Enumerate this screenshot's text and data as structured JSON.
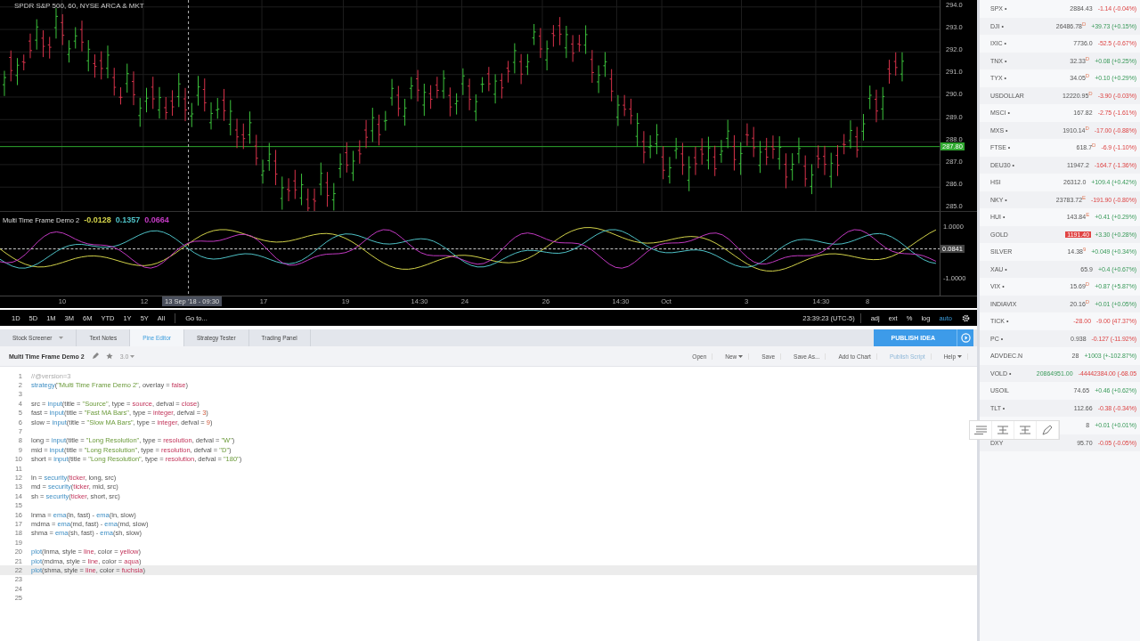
{
  "chart": {
    "title": "SPDR S&P 500, 60, NYSE ARCA & MKT",
    "price_axis": [
      "294.0",
      "293.0",
      "292.0",
      "291.0",
      "290.0",
      "289.0",
      "288.0",
      "287.0",
      "286.0",
      "285.0"
    ],
    "last_price": "287.80",
    "indicator": {
      "name": "Multi Time Frame Demo 2",
      "values": [
        {
          "text": "-0.0128",
          "color": "#d4d44a"
        },
        {
          "text": "0.1357",
          "color": "#4fc3c8"
        },
        {
          "text": "0.0664",
          "color": "#c43ac4"
        }
      ],
      "axis": [
        "1.0000",
        "-1.0000"
      ],
      "last_value": "0.0841"
    },
    "time_axis": [
      "10",
      "12",
      "17",
      "19",
      "14:30",
      "24",
      "26",
      "14:30",
      "Oct",
      "3",
      "14:30",
      "8"
    ],
    "crosshair_time": "13 Sep '18 - 09:30"
  },
  "toolbar": {
    "ranges": [
      "1D",
      "5D",
      "1M",
      "3M",
      "6M",
      "YTD",
      "1Y",
      "5Y",
      "All"
    ],
    "goto": "Go to...",
    "clock": "23:39:23 (UTC-5)",
    "toggles": [
      {
        "label": "adj",
        "on": false
      },
      {
        "label": "ext",
        "on": false
      },
      {
        "label": "%",
        "on": false
      },
      {
        "label": "log",
        "on": false
      },
      {
        "label": "auto",
        "on": true
      }
    ]
  },
  "tabs": [
    {
      "label": "Stock Screener",
      "selected": false,
      "dropdown": true
    },
    {
      "label": "Text Notes",
      "selected": false,
      "dropdown": false
    },
    {
      "label": "Pine Editor",
      "selected": true,
      "dropdown": false
    },
    {
      "label": "Strategy Tester",
      "selected": false,
      "dropdown": false
    },
    {
      "label": "Trading Panel",
      "selected": false,
      "dropdown": false
    }
  ],
  "publish_button": "PUBLISH IDEA",
  "editor": {
    "script_name": "Multi Time Frame Demo 2",
    "version": "3.0",
    "actions": [
      {
        "label": "Open",
        "dropdown": false,
        "muted": false
      },
      {
        "label": "New",
        "dropdown": true,
        "muted": false
      },
      {
        "label": "Save",
        "dropdown": false,
        "muted": false
      },
      {
        "label": "Save As...",
        "dropdown": false,
        "muted": false
      },
      {
        "label": "Add to Chart",
        "dropdown": false,
        "muted": false
      },
      {
        "label": "Publish Script",
        "dropdown": false,
        "muted": true
      },
      {
        "label": "Help",
        "dropdown": true,
        "muted": false
      }
    ],
    "lines": [
      {
        "number": "1",
        "current": false,
        "tokens": [
          {
            "text": "//@version=3",
            "kind": "comment"
          }
        ]
      },
      {
        "number": "2",
        "current": false,
        "tokens": [
          {
            "text": "strategy",
            "kind": "func"
          },
          {
            "text": "(",
            "kind": "plain"
          },
          {
            "text": "\"Multi Time Frame Demo 2\"",
            "kind": "string"
          },
          {
            "text": ", overlay = ",
            "kind": "plain"
          },
          {
            "text": "false",
            "kind": "keyword"
          },
          {
            "text": ")",
            "kind": "plain"
          }
        ]
      },
      {
        "number": "3",
        "current": false
      },
      {
        "number": "4",
        "current": false,
        "tokens": [
          {
            "text": "src = ",
            "kind": "plain"
          },
          {
            "text": "input",
            "kind": "func"
          },
          {
            "text": "(title = ",
            "kind": "plain"
          },
          {
            "text": "\"Source\"",
            "kind": "string"
          },
          {
            "text": ", type = ",
            "kind": "plain"
          },
          {
            "text": "source",
            "kind": "keyword"
          },
          {
            "text": ", defval = ",
            "kind": "plain"
          },
          {
            "text": "close",
            "kind": "keyword"
          },
          {
            "text": ")",
            "kind": "plain"
          }
        ]
      },
      {
        "number": "5",
        "current": false,
        "tokens": [
          {
            "text": "fast = ",
            "kind": "plain"
          },
          {
            "text": "input",
            "kind": "func"
          },
          {
            "text": "(title = ",
            "kind": "plain"
          },
          {
            "text": "\"Fast MA Bars\"",
            "kind": "string"
          },
          {
            "text": ", type = ",
            "kind": "plain"
          },
          {
            "text": "integer",
            "kind": "keyword"
          },
          {
            "text": ", defval = ",
            "kind": "plain"
          },
          {
            "text": "3",
            "kind": "number"
          },
          {
            "text": ")",
            "kind": "plain"
          }
        ]
      },
      {
        "number": "6",
        "current": false,
        "tokens": [
          {
            "text": "slow = ",
            "kind": "plain"
          },
          {
            "text": "input",
            "kind": "func"
          },
          {
            "text": "(title = ",
            "kind": "plain"
          },
          {
            "text": "\"Slow MA Bars\"",
            "kind": "string"
          },
          {
            "text": ", type = ",
            "kind": "plain"
          },
          {
            "text": "integer",
            "kind": "keyword"
          },
          {
            "text": ", defval = ",
            "kind": "plain"
          },
          {
            "text": "9",
            "kind": "number"
          },
          {
            "text": ")",
            "kind": "plain"
          }
        ]
      },
      {
        "number": "7",
        "current": false
      },
      {
        "number": "8",
        "current": false,
        "tokens": [
          {
            "text": "long = ",
            "kind": "plain"
          },
          {
            "text": "input",
            "kind": "func"
          },
          {
            "text": "(title = ",
            "kind": "plain"
          },
          {
            "text": "\"Long Resolution\"",
            "kind": "string"
          },
          {
            "text": ", type = ",
            "kind": "plain"
          },
          {
            "text": "resolution",
            "kind": "keyword"
          },
          {
            "text": ", defval = ",
            "kind": "plain"
          },
          {
            "text": "\"W\"",
            "kind": "string"
          },
          {
            "text": ")",
            "kind": "plain"
          }
        ]
      },
      {
        "number": "9",
        "current": false,
        "tokens": [
          {
            "text": "mid = ",
            "kind": "plain"
          },
          {
            "text": "input",
            "kind": "func"
          },
          {
            "text": "(title = ",
            "kind": "plain"
          },
          {
            "text": "\"Long Resolution\"",
            "kind": "string"
          },
          {
            "text": ", type = ",
            "kind": "plain"
          },
          {
            "text": "resolution",
            "kind": "keyword"
          },
          {
            "text": ", defval = ",
            "kind": "plain"
          },
          {
            "text": "\"D\"",
            "kind": "string"
          },
          {
            "text": ")",
            "kind": "plain"
          }
        ]
      },
      {
        "number": "10",
        "current": false,
        "tokens": [
          {
            "text": "short = ",
            "kind": "plain"
          },
          {
            "text": "input",
            "kind": "func"
          },
          {
            "text": "(title = ",
            "kind": "plain"
          },
          {
            "text": "\"Long Resolution\"",
            "kind": "string"
          },
          {
            "text": ", type = ",
            "kind": "plain"
          },
          {
            "text": "resolution",
            "kind": "keyword"
          },
          {
            "text": ", defval = ",
            "kind": "plain"
          },
          {
            "text": "\"180\"",
            "kind": "string"
          },
          {
            "text": ")",
            "kind": "plain"
          }
        ]
      },
      {
        "number": "11",
        "current": false
      },
      {
        "number": "12",
        "current": false,
        "tokens": [
          {
            "text": "ln = ",
            "kind": "plain"
          },
          {
            "text": "security",
            "kind": "func"
          },
          {
            "text": "(",
            "kind": "plain"
          },
          {
            "text": "ticker",
            "kind": "keyword"
          },
          {
            "text": ", long, src)",
            "kind": "plain"
          }
        ]
      },
      {
        "number": "13",
        "current": false,
        "tokens": [
          {
            "text": "md = ",
            "kind": "plain"
          },
          {
            "text": "security",
            "kind": "func"
          },
          {
            "text": "(",
            "kind": "plain"
          },
          {
            "text": "ticker",
            "kind": "keyword"
          },
          {
            "text": ", mid, src)",
            "kind": "plain"
          }
        ]
      },
      {
        "number": "14",
        "current": false,
        "tokens": [
          {
            "text": "sh = ",
            "kind": "plain"
          },
          {
            "text": "security",
            "kind": "func"
          },
          {
            "text": "(",
            "kind": "plain"
          },
          {
            "text": "ticker",
            "kind": "keyword"
          },
          {
            "text": ", short, src)",
            "kind": "plain"
          }
        ]
      },
      {
        "number": "15",
        "current": false
      },
      {
        "number": "16",
        "current": false,
        "tokens": [
          {
            "text": "lnma = ",
            "kind": "plain"
          },
          {
            "text": "ema",
            "kind": "func"
          },
          {
            "text": "(ln, fast) - ",
            "kind": "plain"
          },
          {
            "text": "ema",
            "kind": "func"
          },
          {
            "text": "(ln, slow)",
            "kind": "plain"
          }
        ]
      },
      {
        "number": "17",
        "current": false,
        "tokens": [
          {
            "text": "mdma = ",
            "kind": "plain"
          },
          {
            "text": "ema",
            "kind": "func"
          },
          {
            "text": "(md, fast) - ",
            "kind": "plain"
          },
          {
            "text": "ema",
            "kind": "func"
          },
          {
            "text": "(md, slow)",
            "kind": "plain"
          }
        ]
      },
      {
        "number": "18",
        "current": false,
        "tokens": [
          {
            "text": "shma = ",
            "kind": "plain"
          },
          {
            "text": "ema",
            "kind": "func"
          },
          {
            "text": "(sh, fast) - ",
            "kind": "plain"
          },
          {
            "text": "ema",
            "kind": "func"
          },
          {
            "text": "(sh, slow)",
            "kind": "plain"
          }
        ]
      },
      {
        "number": "19",
        "current": false
      },
      {
        "number": "20",
        "current": false,
        "tokens": [
          {
            "text": "plot",
            "kind": "func"
          },
          {
            "text": "(lnma, style = ",
            "kind": "plain"
          },
          {
            "text": "line",
            "kind": "keyword"
          },
          {
            "text": ", color = ",
            "kind": "plain"
          },
          {
            "text": "yellow",
            "kind": "keyword"
          },
          {
            "text": ")",
            "kind": "plain"
          }
        ]
      },
      {
        "number": "21",
        "current": false,
        "tokens": [
          {
            "text": "plot",
            "kind": "func"
          },
          {
            "text": "(mdma, style = ",
            "kind": "plain"
          },
          {
            "text": "line",
            "kind": "keyword"
          },
          {
            "text": ", color = ",
            "kind": "plain"
          },
          {
            "text": "aqua",
            "kind": "keyword"
          },
          {
            "text": ")",
            "kind": "plain"
          }
        ]
      },
      {
        "number": "22",
        "current": true,
        "tokens": [
          {
            "text": "plot",
            "kind": "func"
          },
          {
            "text": "(shma, style = ",
            "kind": "plain"
          },
          {
            "text": "line",
            "kind": "keyword"
          },
          {
            "text": ", color = ",
            "kind": "plain"
          },
          {
            "text": "fuchsia",
            "kind": "keyword"
          },
          {
            "text": ")",
            "kind": "plain"
          }
        ]
      },
      {
        "number": "23",
        "current": false
      },
      {
        "number": "24",
        "current": false
      },
      {
        "number": "25",
        "current": false
      }
    ]
  },
  "watchlist": [
    {
      "symbol": "SPX •",
      "price": "2884.43",
      "highlighted": false,
      "price_down": false,
      "price_up": false,
      "change": "-1.14 (-0.04%)",
      "change_up": false
    },
    {
      "symbol": "DJI •",
      "price": "26486.78$^{D}$",
      "highlighted": false,
      "price_down": false,
      "price_up": false,
      "change": "+39.73 (+0.15%)",
      "change_up": true
    },
    {
      "symbol": "IXIC •",
      "price": "7736.0",
      "highlighted": false,
      "price_down": false,
      "price_up": false,
      "change": "-52.5 (-0.67%)",
      "change_up": false
    },
    {
      "symbol": "TNX •",
      "price": "32.33$^{D}$",
      "highlighted": false,
      "price_down": false,
      "price_up": false,
      "change": "+0.08 (+0.25%)",
      "change_up": true
    },
    {
      "symbol": "TYX •",
      "price": "34.05$^{D}$",
      "highlighted": false,
      "price_down": false,
      "price_up": false,
      "change": "+0.10 (+0.29%)",
      "change_up": true
    },
    {
      "symbol": "USDOLLAR",
      "price": "12220.95$^{D}$",
      "highlighted": false,
      "price_down": false,
      "price_up": false,
      "change": "-3.90 (-0.03%)",
      "change_up": false
    },
    {
      "symbol": "MSCI •",
      "price": "167.82",
      "highlighted": false,
      "price_down": false,
      "price_up": false,
      "change": "-2.75 (-1.61%)",
      "change_up": false
    },
    {
      "symbol": "MXS •",
      "price": "1910.14$^{D}$",
      "highlighted": false,
      "price_down": false,
      "price_up": false,
      "change": "-17.00 (-0.88%)",
      "change_up": false
    },
    {
      "symbol": "FTSE •",
      "price": "618.7$^{D}$",
      "highlighted": false,
      "price_down": false,
      "price_up": false,
      "change": "-6.9 (-1.10%)",
      "change_up": false
    },
    {
      "symbol": "DEU30 •",
      "price": "11947.2",
      "highlighted": false,
      "price_down": false,
      "price_up": false,
      "change": "-164.7 (-1.36%)",
      "change_up": false
    },
    {
      "symbol": "HSI",
      "price": "26312.0",
      "highlighted": false,
      "price_down": false,
      "price_up": false,
      "change": "+109.4 (+0.42%)",
      "change_up": true
    },
    {
      "symbol": "NKY •",
      "price": "23783.72$^{E}$",
      "highlighted": false,
      "price_down": false,
      "price_up": false,
      "change": "-191.90 (-0.80%)",
      "change_up": false
    },
    {
      "symbol": "HUI •",
      "price": "143.84$^{E}$",
      "highlighted": false,
      "price_down": false,
      "price_up": false,
      "change": "+0.41 (+0.29%)",
      "change_up": true
    },
    {
      "symbol": "GOLD",
      "price": "1191.40",
      "highlighted": true,
      "price_down": false,
      "price_up": false,
      "change": "+3.30 (+0.28%)",
      "change_up": true
    },
    {
      "symbol": "SILVER",
      "price": "14.38$^{9}$",
      "highlighted": false,
      "price_down": false,
      "price_up": false,
      "change": "+0.049 (+0.34%)",
      "change_up": true
    },
    {
      "symbol": "XAU •",
      "price": "65.9",
      "highlighted": false,
      "price_down": false,
      "price_up": false,
      "change": "+0.4 (+0.67%)",
      "change_up": true
    },
    {
      "symbol": "VIX •",
      "price": "15.69$^{D}$",
      "highlighted": false,
      "price_down": false,
      "price_up": false,
      "change": "+0.87 (+5.87%)",
      "change_up": true
    },
    {
      "symbol": "INDIAVIX",
      "price": "20.16$^{D}$",
      "highlighted": false,
      "price_down": false,
      "price_up": false,
      "change": "+0.01 (+0.05%)",
      "change_up": true
    },
    {
      "symbol": "TICK •",
      "price": "-28.00",
      "highlighted": false,
      "price_down": true,
      "price_up": false,
      "change": "-9.00 (47.37%)",
      "change_up": false
    },
    {
      "symbol": "PC •",
      "price": "0.938",
      "highlighted": false,
      "price_down": false,
      "price_up": false,
      "change": "-0.127 (-11.92%)",
      "change_up": false
    },
    {
      "symbol": "ADVDEC.N",
      "price": "28",
      "highlighted": false,
      "price_down": false,
      "price_up": false,
      "change": "+1003 (+-102.87%)",
      "change_up": true
    },
    {
      "symbol": "VOLD •",
      "price": "20864951.00",
      "highlighted": false,
      "price_down": false,
      "price_up": true,
      "change": "-44442384.00 (-68.05",
      "change_up": false
    },
    {
      "symbol": "USOIL",
      "price": "74.65",
      "highlighted": false,
      "price_down": false,
      "price_up": false,
      "change": "+0.46 (+0.62%)",
      "change_up": true
    },
    {
      "symbol": "TLT •",
      "price": "112.66",
      "highlighted": false,
      "price_down": false,
      "price_up": false,
      "change": "-0.38 (-0.34%)",
      "change_up": false
    },
    {
      "price": "8",
      "highlighted": false,
      "price_down": false,
      "price_up": false,
      "change": "+0.01 (+0.01%)",
      "change_up": true
    },
    {
      "symbol": "DXY",
      "price": "95.70",
      "highlighted": false,
      "price_down": false,
      "price_up": false,
      "change": "-0.05 (-0.05%)",
      "change_up": false
    }
  ]
}
